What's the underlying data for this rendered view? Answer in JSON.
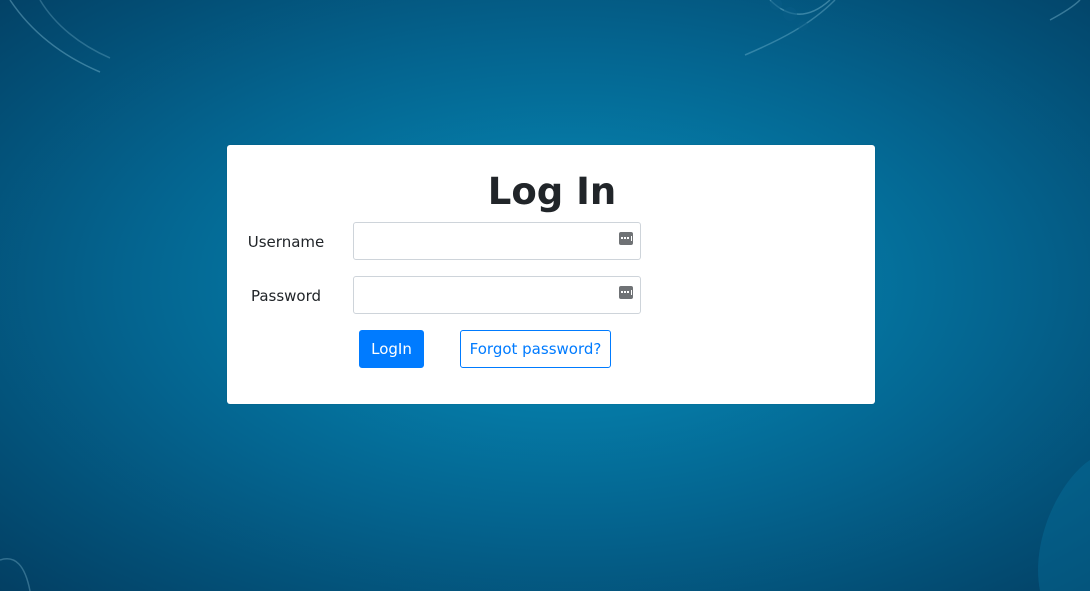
{
  "login": {
    "title": "Log In",
    "username_label": "Username",
    "username_value": "",
    "password_label": "Password",
    "password_value": "",
    "login_button": "LogIn",
    "forgot_button": "Forgot password?"
  },
  "icons": {
    "field_icon": "password-manager-key-icon"
  },
  "colors": {
    "background": "#057aa6",
    "card": "#ffffff",
    "primary": "#007bff",
    "text": "#212529",
    "input_border": "#ced4da"
  }
}
